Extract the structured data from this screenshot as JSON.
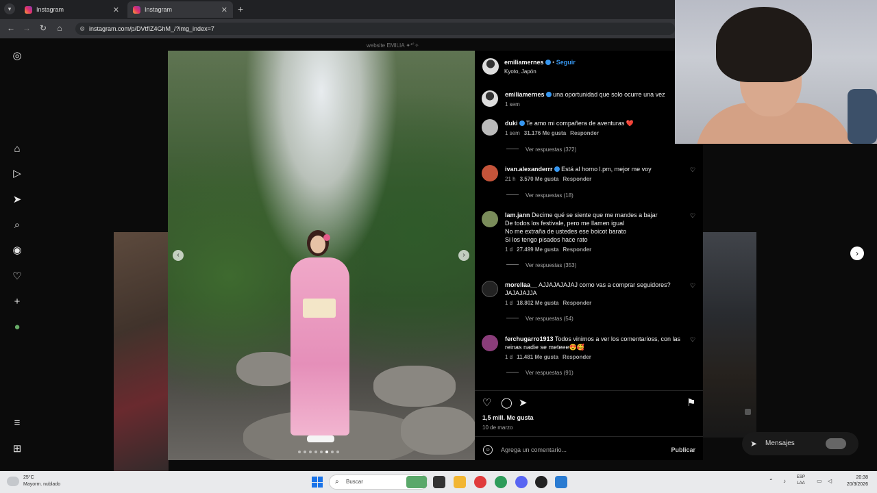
{
  "browser": {
    "tabs": [
      {
        "label": "Instagram",
        "active": false
      },
      {
        "label": "Instagram",
        "active": true
      }
    ],
    "url": "instagram.com/p/DVtfIZ4GhM_/?img_index=7"
  },
  "page_hint": "website EMILIA ✦*˚✧",
  "post": {
    "username": "emiliamernes",
    "verified": true,
    "follow_label": "Seguir",
    "separator": "•",
    "location": "Kyoto, Japón",
    "caption": {
      "username": "emiliamernes",
      "text": "una oportunidad que solo ocurre una vez",
      "time": "1 sem"
    },
    "likes": "1,5 mill. Me gusta",
    "date": "10 de marzo",
    "add_comment_placeholder": "Agrega un comentario...",
    "publish_label": "Publicar"
  },
  "comments": [
    {
      "username": "duki",
      "verified": true,
      "text": "Te amo mi compañera de aventuras ❤️",
      "time": "1 sem",
      "likes": "31.176 Me gusta",
      "reply": "Responder",
      "replies": "Ver respuestas (372)"
    },
    {
      "username": "ivan.alexanderrr",
      "verified": true,
      "text": "Está al horno l.pm, mejor me voy",
      "time": "21 h",
      "likes": "3.570 Me gusta",
      "reply": "Responder",
      "replies": "Ver respuestas (18)"
    },
    {
      "username": "lam.jann",
      "verified": false,
      "text_lines": [
        "Decime qué se siente que me mandes a bajar",
        "De todos los festivale, pero me llamen igual",
        "No me extraña de ustedes ese boicot barato",
        "Si los tengo pisados hace rato"
      ],
      "time": "1 d",
      "likes": "27.499 Me gusta",
      "reply": "Responder",
      "replies": "Ver respuestas (353)"
    },
    {
      "username": "morellaa__",
      "verified": false,
      "text_lines": [
        "AJJAJAJAJAJ como vas a comprar seguidores?",
        "JAJAJAJJA"
      ],
      "time": "1 d",
      "likes": "18.802 Me gusta",
      "reply": "Responder",
      "replies": "Ver respuestas (54)"
    },
    {
      "username": "ferchugarro1913",
      "verified": false,
      "text_lines": [
        "Todos vinimos a ver los comentarioss, con las",
        "reinas nadie se meteee😍🥰"
      ],
      "time": "1 d",
      "likes": "11.481 Me gusta",
      "reply": "Responder",
      "replies": "Ver respuestas (91)"
    }
  ],
  "messages_label": "Mensajes",
  "icons": {
    "sidebar": [
      "instagram-icon",
      "home-icon",
      "reels-icon",
      "send-icon",
      "search-icon",
      "explore-icon",
      "heart-icon",
      "create-icon",
      "profile-icon",
      "menu-icon",
      "apps-icon"
    ],
    "actions": [
      "like-icon",
      "comment-icon",
      "share-icon",
      "save-icon"
    ]
  },
  "taskbar": {
    "weather_temp": "25°C",
    "weather_desc": "Mayorm. nublado",
    "search_placeholder": "Buscar",
    "lang_1": "ESP",
    "lang_2": "LAA",
    "time": "20:38",
    "date": "20/3/2026"
  },
  "colors": {
    "instagram_blue": "#3797f0",
    "heart_red": "#ff3040",
    "panel_bg": "#000000"
  }
}
